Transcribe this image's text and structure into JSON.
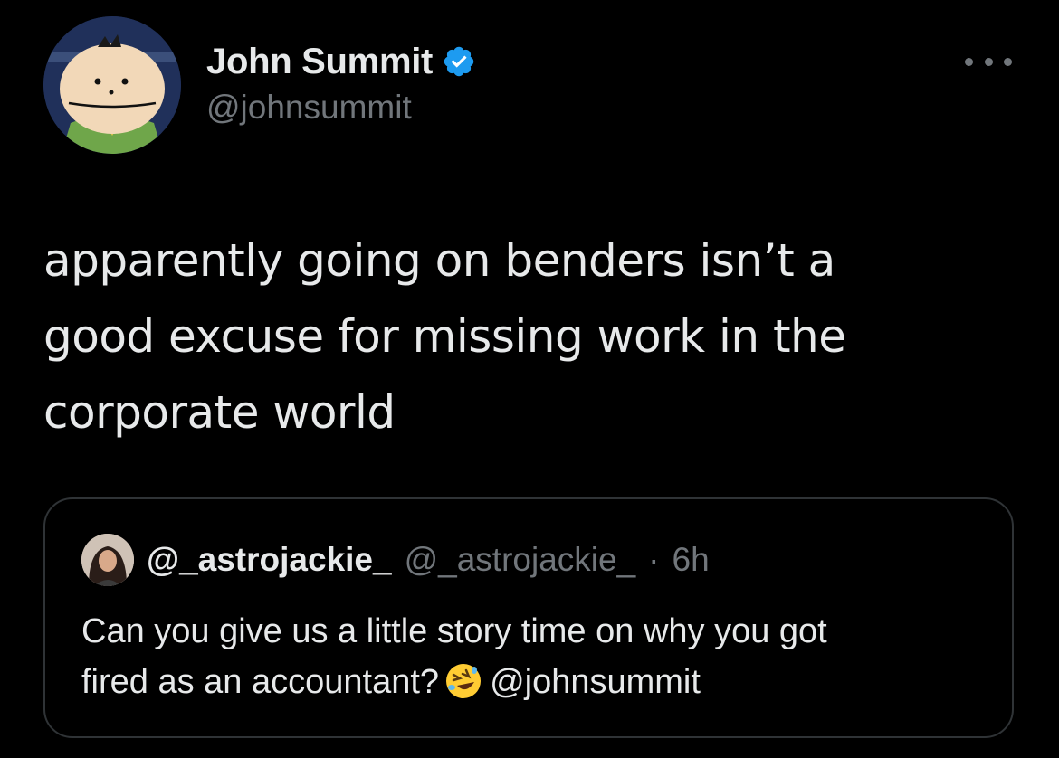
{
  "tweet": {
    "author": {
      "display_name": "John Summit",
      "handle": "@johnsummit",
      "verified": true,
      "avatar_icon": "cartoon-avatar-icon"
    },
    "text_lines": [
      "apparently going on benders isn’t a",
      "good excuse for missing work in the",
      "corporate world"
    ],
    "quoted": {
      "display_name": "@_astrojackie_",
      "handle": "@_astrojackie_",
      "separator": "·",
      "time": "6h",
      "text_line1": "Can you give us a little story time on why you got",
      "text_line2_before_emoji": "fired as an accountant?",
      "emoji": "rolling-on-floor-laughing-emoji",
      "text_line2_after_emoji": "@johnsummit"
    }
  },
  "colors": {
    "background": "#000000",
    "text_primary": "#e7e9ea",
    "text_secondary": "#71767b",
    "border": "#2f3336",
    "verified_blue": "#1d9bf0"
  }
}
